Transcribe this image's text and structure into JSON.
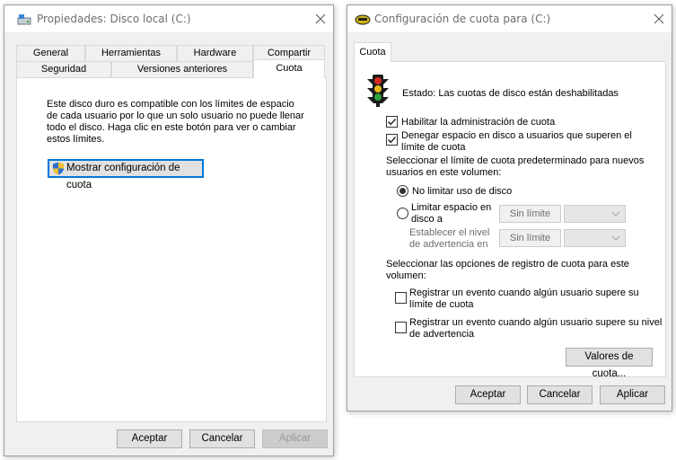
{
  "props_window": {
    "title": "Propiedades: Disco local (C:)",
    "tabs_row1": [
      "General",
      "Herramientas",
      "Hardware",
      "Compartir"
    ],
    "tabs_row2": [
      "Seguridad",
      "Versiones anteriores",
      "Cuota"
    ],
    "active_tab": "Cuota",
    "description": "Este disco duro es compatible con los límites de espacio de cada usuario por lo que un solo usuario no puede llenar todo el disco. Haga clic en este botón para ver o cambiar estos límites.",
    "show_quota_button": "Mostrar configuración de cuota",
    "buttons": {
      "accept": "Aceptar",
      "cancel": "Cancelar",
      "apply": "Aplicar"
    }
  },
  "quota_window": {
    "title": "Configuración de cuota para  (C:)",
    "tab": "Cuota",
    "status": "Estado:  Las cuotas de disco están deshabilitadas",
    "enable_quota": {
      "label": "Habilitar la administración de cuota",
      "checked": true
    },
    "deny_space": {
      "label": "Denegar espacio en disco a usuarios que superen el límite de cuota",
      "checked": true
    },
    "default_limit_heading": "Seleccionar el límite de cuota predeterminado para nuevos usuarios en este volumen:",
    "no_limit": {
      "label": "No limitar uso de disco",
      "selected": true
    },
    "limit_space": {
      "label": "Limitar espacio en disco a",
      "selected": false,
      "value": "Sin límite"
    },
    "warning_level": {
      "label": "Establecer el nivel de advertencia en",
      "value": "Sin límite"
    },
    "logging_heading": "Seleccionar las opciones de registro de cuota para este volumen:",
    "log_over_limit": {
      "label": "Registrar un evento cuando algún usuario supere su límite de cuota",
      "checked": false
    },
    "log_over_warning": {
      "label": "Registrar un evento cuando algún usuario supere su nivel de advertencia",
      "checked": false
    },
    "quota_values_button": "Valores de cuota...",
    "buttons": {
      "accept": "Aceptar",
      "cancel": "Cancelar",
      "apply": "Aplicar"
    }
  },
  "colors": {
    "accent": "#0078d7",
    "window_bg": "#f0f0f0",
    "disabled_text": "#9a9a9a"
  }
}
